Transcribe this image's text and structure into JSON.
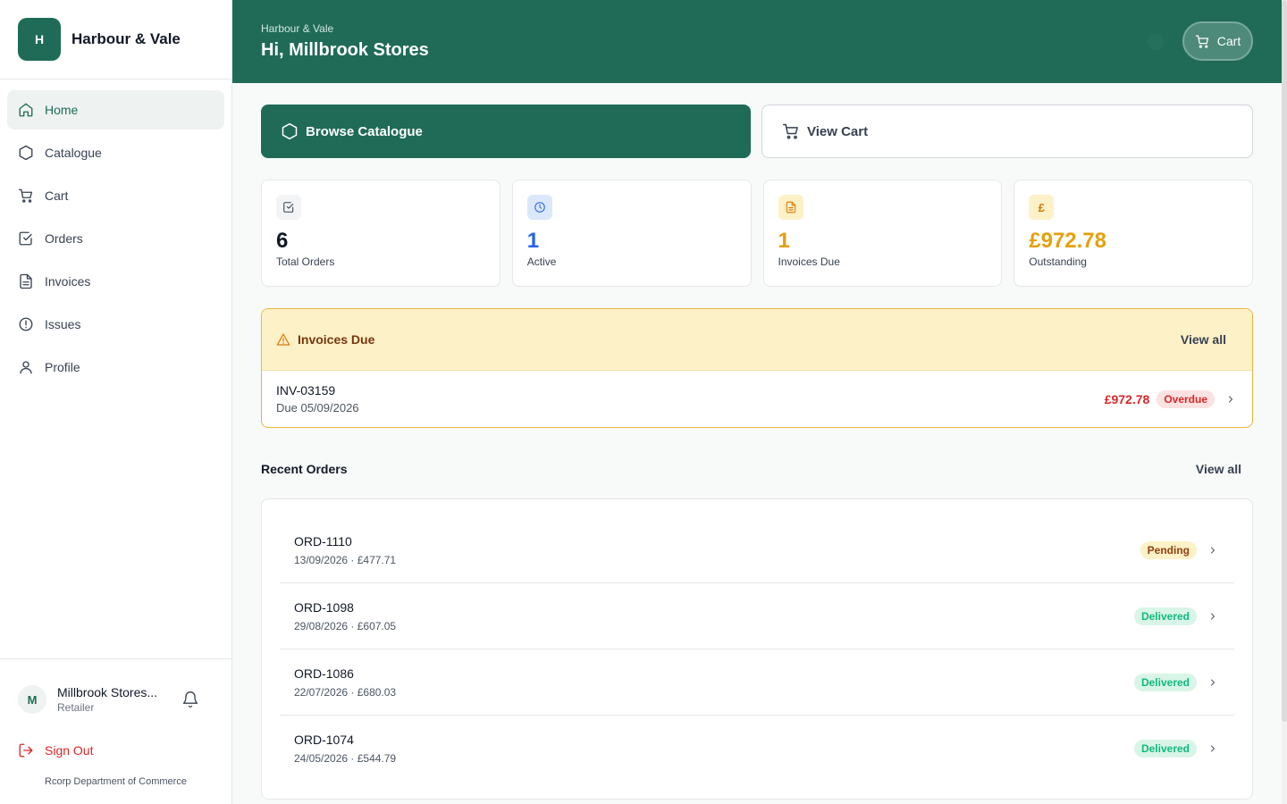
{
  "brand": {
    "logo_letter": "H",
    "name": "Harbour & Vale"
  },
  "sidebar": {
    "items": [
      {
        "label": "Home",
        "icon": "home-icon",
        "active": true
      },
      {
        "label": "Catalogue",
        "icon": "hexagon-icon",
        "active": false
      },
      {
        "label": "Cart",
        "icon": "cart-icon",
        "active": false
      },
      {
        "label": "Orders",
        "icon": "checkbox-icon",
        "active": false
      },
      {
        "label": "Invoices",
        "icon": "document-icon",
        "active": false
      },
      {
        "label": "Issues",
        "icon": "alert-circle-icon",
        "active": false
      },
      {
        "label": "Profile",
        "icon": "user-icon",
        "active": false
      }
    ],
    "user": {
      "initial": "M",
      "name": "Millbrook Stores...",
      "role": "Retailer"
    },
    "sign_out": "Sign Out",
    "footer": "Rcorp Department of Commerce"
  },
  "header": {
    "subtitle": "Harbour & Vale",
    "title": "Hi, Millbrook Stores",
    "cart_label": "Cart"
  },
  "actions": {
    "browse": "Browse Catalogue",
    "view_cart": "View Cart"
  },
  "stats": [
    {
      "value": "6",
      "label": "Total Orders",
      "color": "#111827",
      "icon": "checkbox-icon",
      "icon_bg": "#f3f4f6",
      "icon_color": "#374151"
    },
    {
      "value": "1",
      "label": "Active",
      "color": "#2563eb",
      "icon": "clock-icon",
      "icon_bg": "#dbe7fb",
      "icon_color": "#2563eb"
    },
    {
      "value": "1",
      "label": "Invoices Due",
      "color": "#e5a00d",
      "icon": "document-icon",
      "icon_bg": "#fdf1c7",
      "icon_color": "#d97706"
    },
    {
      "value": "£972.78",
      "label": "Outstanding",
      "color": "#e5a00d",
      "icon": "pound-icon",
      "icon_bg": "#fdf1c7",
      "icon_color": "#d97706"
    }
  ],
  "invoices": {
    "title": "Invoices Due",
    "view_all": "View all",
    "rows": [
      {
        "id": "INV-03159",
        "due": "Due 05/09/2026",
        "amount": "£972.78",
        "status": "Overdue"
      }
    ]
  },
  "recent_orders": {
    "title": "Recent Orders",
    "view_all": "View all",
    "rows": [
      {
        "id": "ORD-1110",
        "meta": "13/09/2026 · £477.71",
        "status": "Pending"
      },
      {
        "id": "ORD-1098",
        "meta": "29/08/2026 · £607.05",
        "status": "Delivered"
      },
      {
        "id": "ORD-1086",
        "meta": "22/07/2026 · £680.03",
        "status": "Delivered"
      },
      {
        "id": "ORD-1074",
        "meta": "24/05/2026 · £544.79",
        "status": "Delivered"
      }
    ]
  },
  "colors": {
    "brand": "#1f6b57",
    "warning_bg": "#fdf1c7",
    "danger": "#dc2626",
    "success": "#10b981"
  }
}
